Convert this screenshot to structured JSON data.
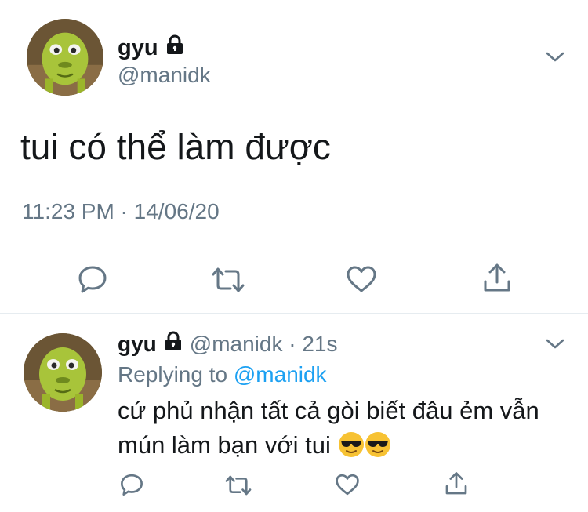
{
  "tweet": {
    "author_name": "gyu",
    "author_handle": "@manidk",
    "text": "tui có thể làm được",
    "timestamp": "11:23 PM · 14/06/20",
    "actions": [
      "reply-icon",
      "retweet-icon",
      "like-icon",
      "share-icon"
    ]
  },
  "reply": {
    "author_name": "gyu",
    "handle_time": "@manidk · 21s",
    "replying_prefix": "Replying to ",
    "replying_mention": "@manidk",
    "text": "cứ phủ nhận tất cả gòi biết đâu ẻm vẫn mún làm bạn với tui",
    "emojis": [
      "sunglasses-emoji",
      "sunglasses-emoji"
    ],
    "actions": [
      "reply-icon",
      "retweet-icon",
      "like-icon",
      "share-icon"
    ]
  },
  "colors": {
    "text": "#14171a",
    "secondary": "#657786",
    "link": "#1da1f2",
    "divider": "#ccd6dd"
  }
}
